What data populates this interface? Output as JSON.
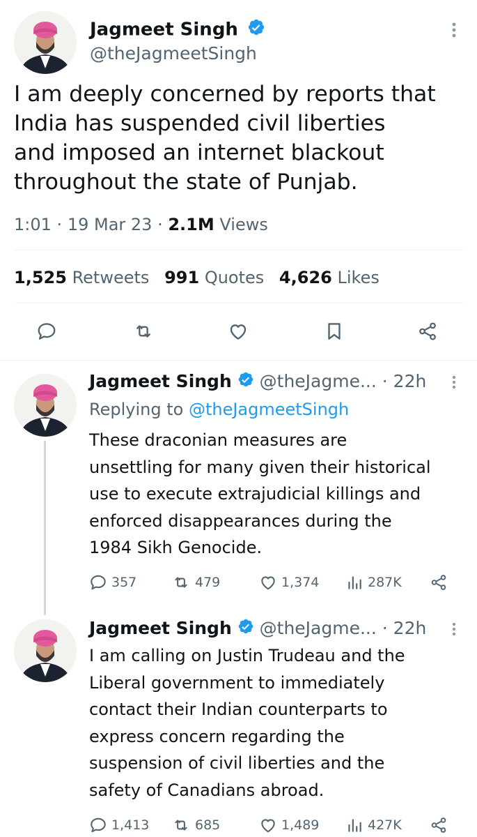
{
  "main_tweet": {
    "name": "Jagmeet Singh",
    "handle": "@theJagmeetSingh",
    "text_lines": [
      "I am deeply concerned by reports that",
      "India has suspended civil liberties",
      "and imposed an internet blackout",
      "throughout the state of Punjab."
    ],
    "time": "1:01",
    "date": "19 Mar 23",
    "views_count": "2.1M",
    "views_label": "Views",
    "retweets_count": "1,525",
    "retweets_label": "Retweets",
    "quotes_count": "991",
    "quotes_label": "Quotes",
    "likes_count": "4,626",
    "likes_label": "Likes"
  },
  "replies": [
    {
      "name": "Jagmeet Singh",
      "handle": "@theJagme...",
      "time": "· 22h",
      "replying_label": "Replying to",
      "replying_handle": "@theJagmeetSingh",
      "text_lines": [
        "These draconian measures are",
        "unsettling for many given their historical",
        "use to execute extrajudicial killings and",
        "enforced disappearances during the",
        "1984 Sikh Genocide."
      ],
      "replies_count": "357",
      "retweets_count": "479",
      "likes_count": "1,374",
      "views_count": "287K"
    },
    {
      "name": "Jagmeet Singh",
      "handle": "@theJagme...",
      "time": "· 22h",
      "text_lines": [
        "I am calling on Justin Trudeau and the",
        "Liberal government to immediately",
        "contact their Indian counterparts to",
        "express concern regarding the",
        "suspension of civil liberties and the",
        "safety of Canadians abroad."
      ],
      "replies_count": "1,413",
      "retweets_count": "685",
      "likes_count": "1,489",
      "views_count": "427K"
    }
  ],
  "colors": {
    "text": "#0f1419",
    "muted": "#536471",
    "link": "#1d9bf0",
    "verified": "#1d9bf0",
    "divider": "#eff3f4"
  },
  "icons": [
    "verified-badge-icon",
    "more-icon",
    "reply-icon",
    "retweet-icon",
    "like-icon",
    "bookmark-icon",
    "share-icon",
    "views-icon"
  ]
}
